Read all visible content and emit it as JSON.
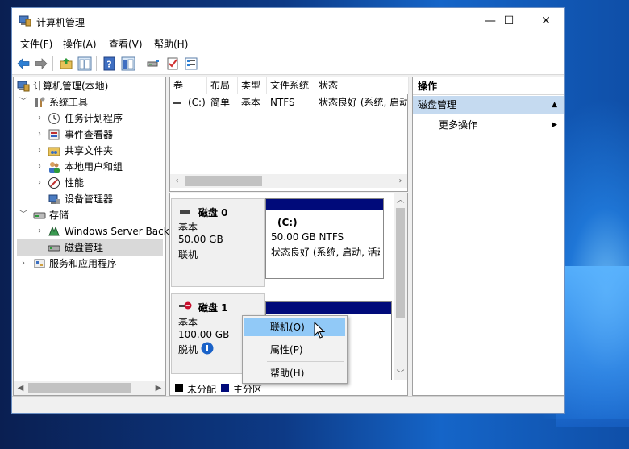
{
  "window": {
    "title": "计算机管理",
    "controls": {
      "minimize": "—",
      "maximize": "☐",
      "close": "✕"
    }
  },
  "menu": [
    "文件(F)",
    "操作(A)",
    "查看(V)",
    "帮助(H)"
  ],
  "toolbar_icons": [
    "back-arrow-icon",
    "forward-arrow-icon",
    "up-folder-icon",
    "show-tree-icon",
    "help-icon",
    "show-console-icon",
    "connect-icon",
    "check-icon",
    "properties-icon"
  ],
  "tree": {
    "root": "计算机管理(本地)",
    "system_tools": "系统工具",
    "task_scheduler": "任务计划程序",
    "event_viewer": "事件查看器",
    "shared_folders": "共享文件夹",
    "local_users": "本地用户和组",
    "performance": "性能",
    "device_manager": "设备管理器",
    "storage": "存储",
    "windows_backup": "Windows Server Backup",
    "disk_management": "磁盘管理",
    "services": "服务和应用程序"
  },
  "volume_table": {
    "columns": [
      "卷",
      "布局",
      "类型",
      "文件系统",
      "状态"
    ],
    "rows": [
      {
        "volume": "(C:)",
        "layout": "简单",
        "type": "基本",
        "fs": "NTFS",
        "status": "状态良好 (系统, 启动"
      }
    ]
  },
  "disks": [
    {
      "name": "磁盘 0",
      "type": "基本",
      "size": "50.00 GB",
      "state": "联机",
      "partition": {
        "label": "(C:)",
        "size_fs": "50.00 GB NTFS",
        "status": "状态良好 (系统, 启动, 活动"
      }
    },
    {
      "name": "磁盘 1",
      "type": "基本",
      "size": "100.00 GB",
      "state": "脱机"
    }
  ],
  "legend": {
    "unallocated": "未分配",
    "primary": "主分区"
  },
  "context_menu": {
    "online": "联机(O)",
    "properties": "属性(P)",
    "help": "帮助(H)"
  },
  "actions": {
    "header": "操作",
    "section": "磁盘管理",
    "more": "更多操作"
  },
  "colors": {
    "partition_bar": "#000a7a",
    "highlight": "#91c9f7",
    "section": "#c5daf0"
  }
}
